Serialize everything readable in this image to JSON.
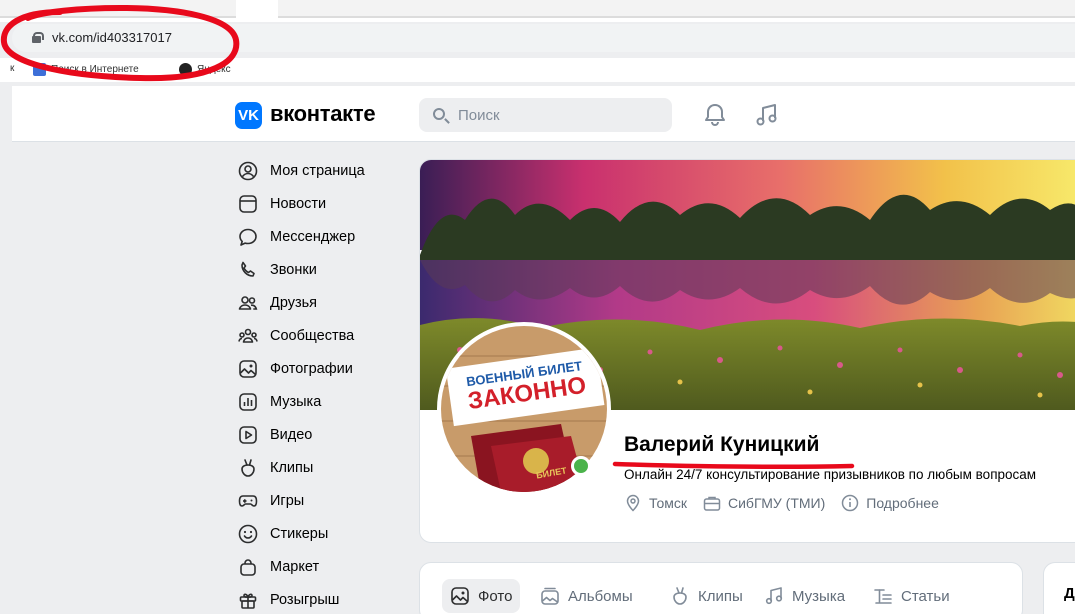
{
  "browser": {
    "url": "vk.com/id403317017",
    "bookmarks": [
      {
        "label": "к"
      },
      {
        "label": "Поиск в Интернете"
      },
      {
        "label": "Яндекс"
      }
    ]
  },
  "header": {
    "brand": "вконтакте",
    "logo_text": "VK",
    "search_placeholder": "Поиск"
  },
  "sidebar": {
    "items": [
      {
        "label": "Моя страница",
        "icon": "user-circle-icon"
      },
      {
        "label": "Новости",
        "icon": "newsfeed-icon"
      },
      {
        "label": "Мессенджер",
        "icon": "message-icon"
      },
      {
        "label": "Звонки",
        "icon": "phone-icon"
      },
      {
        "label": "Друзья",
        "icon": "friends-icon"
      },
      {
        "label": "Сообщества",
        "icon": "communities-icon"
      },
      {
        "label": "Фотографии",
        "icon": "photo-icon"
      },
      {
        "label": "Музыка",
        "icon": "music-icon"
      },
      {
        "label": "Видео",
        "icon": "video-icon"
      },
      {
        "label": "Клипы",
        "icon": "clips-icon"
      },
      {
        "label": "Игры",
        "icon": "gamepad-icon"
      },
      {
        "label": "Стикеры",
        "icon": "smile-icon"
      },
      {
        "label": "Маркет",
        "icon": "market-bag-icon"
      },
      {
        "label": "Розыгрыш",
        "icon": "gift-icon"
      }
    ]
  },
  "profile": {
    "name": "Валерий Куницкий",
    "status": "Онлайн 24/7 консультирование призывников по любым вопросам",
    "avatar_text_top": "ВОЕННЫЙ БИЛЕТ",
    "avatar_text_main": "ЗАКОННО",
    "avatar_text_passport": "БИЛЕТ",
    "city": "Томск",
    "university": "СибГМУ (ТМИ)",
    "more": "Подробнее",
    "online": true
  },
  "tabs": [
    {
      "label": "Фото",
      "icon": "photo-icon",
      "active": true
    },
    {
      "label": "Альбомы",
      "icon": "albums-icon",
      "active": false
    },
    {
      "label": "Клипы",
      "icon": "clips-icon",
      "active": false
    },
    {
      "label": "Музыка",
      "icon": "music-icon",
      "active": false
    },
    {
      "label": "Статьи",
      "icon": "articles-icon",
      "active": false
    }
  ],
  "right_card": {
    "label": "Д"
  },
  "colors": {
    "accent": "#0077ff",
    "online": "#4bb34b",
    "annotation": "#e8091b",
    "background": "#edeef0"
  }
}
